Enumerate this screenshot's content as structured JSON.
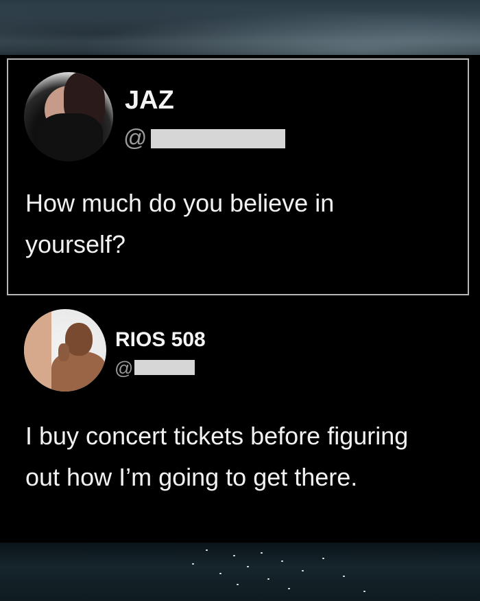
{
  "tweets": [
    {
      "author_name": "JAZ",
      "handle_visible": "@",
      "text_lines": [
        "How much do you believe in",
        "yourself?"
      ]
    },
    {
      "author_name": "RIOS 508",
      "handle_visible": "@",
      "text_lines": [
        "I buy concert tickets before figuring",
        "out how I’m going to get there."
      ]
    }
  ]
}
